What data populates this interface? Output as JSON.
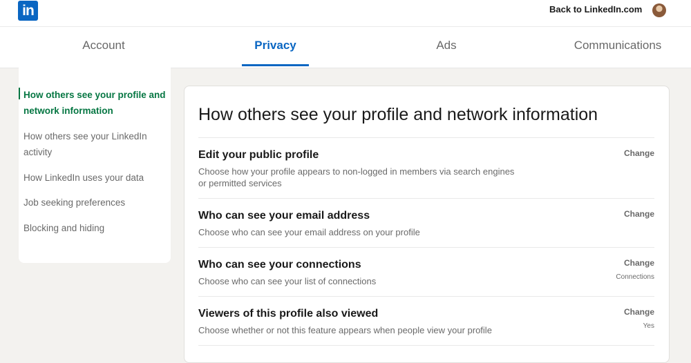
{
  "header": {
    "logo_text": "in",
    "back_link": "Back to LinkedIn.com"
  },
  "tabs": [
    {
      "label": "Account"
    },
    {
      "label": "Privacy"
    },
    {
      "label": "Ads"
    },
    {
      "label": "Communications"
    }
  ],
  "active_tab": "Privacy",
  "sidebar": {
    "items": [
      {
        "label": "How others see your profile and network information"
      },
      {
        "label": "How others see your LinkedIn activity"
      },
      {
        "label": "How LinkedIn uses your data"
      },
      {
        "label": "Job seeking preferences"
      },
      {
        "label": "Blocking and hiding"
      }
    ]
  },
  "main": {
    "title": "How others see your profile and network information",
    "change_label": "Change",
    "settings": [
      {
        "title": "Edit your public profile",
        "description": "Choose how your profile appears to non-logged in members via search engines or permitted services",
        "value": ""
      },
      {
        "title": "Who can see your email address",
        "description": "Choose who can see your email address on your profile",
        "value": ""
      },
      {
        "title": "Who can see your connections",
        "description": "Choose who can see your list of connections",
        "value": "Connections"
      },
      {
        "title": "Viewers of this profile also viewed",
        "description": "Choose whether or not this feature appears when people view your profile",
        "value": "Yes"
      }
    ]
  },
  "colors": {
    "brand_blue": "#0a66c2",
    "active_green": "#057642",
    "page_background": "#f3f2ef"
  }
}
